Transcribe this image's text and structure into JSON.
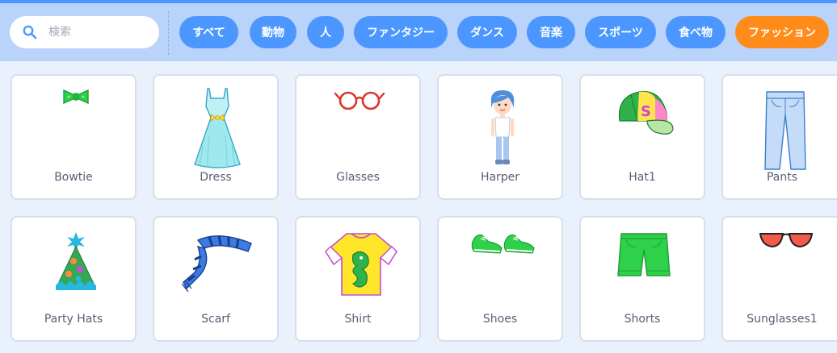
{
  "search": {
    "placeholder": "検索"
  },
  "tags": [
    {
      "label": "すべて",
      "active": false
    },
    {
      "label": "動物",
      "active": false
    },
    {
      "label": "人",
      "active": false
    },
    {
      "label": "ファンタジー",
      "active": false
    },
    {
      "label": "ダンス",
      "active": false
    },
    {
      "label": "音楽",
      "active": false
    },
    {
      "label": "スポーツ",
      "active": false
    },
    {
      "label": "食べ物",
      "active": false
    },
    {
      "label": "ファッション",
      "active": true
    }
  ],
  "items": [
    {
      "label": "Bowtie",
      "icon": "bowtie-icon"
    },
    {
      "label": "Dress",
      "icon": "dress-icon"
    },
    {
      "label": "Glasses",
      "icon": "glasses-icon"
    },
    {
      "label": "Harper",
      "icon": "harper-icon"
    },
    {
      "label": "Hat1",
      "icon": "cap-icon"
    },
    {
      "label": "Pants",
      "icon": "pants-icon"
    },
    {
      "label": "Party Hats",
      "icon": "party-hat-icon"
    },
    {
      "label": "Scarf",
      "icon": "scarf-icon"
    },
    {
      "label": "Shirt",
      "icon": "shirt-icon"
    },
    {
      "label": "Shoes",
      "icon": "shoes-icon"
    },
    {
      "label": "Shorts",
      "icon": "shorts-icon"
    },
    {
      "label": "Sunglasses1",
      "icon": "sunglasses-icon"
    }
  ],
  "colors": {
    "accent": "#4c97ff",
    "active": "#ff8c1a",
    "header": "#b9d3fb",
    "background": "#e9f1fc",
    "text": "#575e75"
  }
}
